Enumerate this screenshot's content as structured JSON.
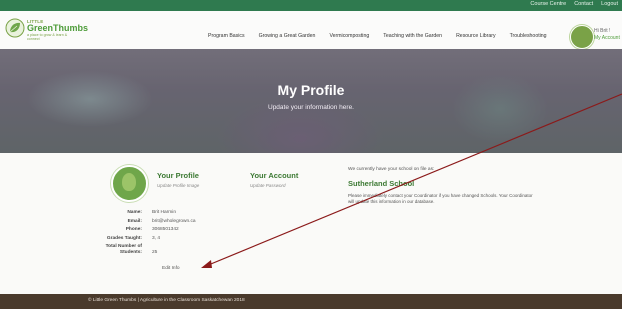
{
  "topbar": {
    "links": [
      "Course Centre",
      "Contact",
      "Logout"
    ]
  },
  "logo": {
    "little": "LITTLE",
    "name": "GreenThumbs",
    "tagline": "a place to grow & learn & connect"
  },
  "nav": [
    "Program Basics",
    "Growing a Great Garden",
    "Vermicomposting",
    "Teaching with the Garden",
    "Resource Library",
    "Troubleshooting"
  ],
  "user": {
    "greeting": "Hi Brit !",
    "account_link": "My Account"
  },
  "hero": {
    "title": "My Profile",
    "subtitle": "Update your information here."
  },
  "profile": {
    "heading": "Your Profile",
    "image_link": "Update Profile Image",
    "fields": [
      {
        "label": "Name:",
        "value": "Brit Harmin"
      },
      {
        "label": "Email:",
        "value": "brit@wholegrown.ca"
      },
      {
        "label": "Phone:",
        "value": "3068501342"
      },
      {
        "label": "Grades Taught:",
        "value": "3, 4"
      },
      {
        "label": "Total Number of Students:",
        "value": "25"
      }
    ],
    "edit_link": "Edit Info"
  },
  "account": {
    "heading": "Your Account",
    "password_link": "Update Password"
  },
  "school": {
    "intro": "We currently have your school on file as:",
    "name": "Sutherland School",
    "note": "Please immediately contact your Coordinator if you have changed Schools. Your Coordinator will update this information in our database."
  },
  "footer": {
    "text": "© Little Green Thumbs | Agriculture in the Classroom Saskatchewan 2018"
  },
  "colors": {
    "topbar": "#2f7a4f",
    "accent_green": "#3d7a34",
    "footer": "#4a3a2c",
    "arrow": "#8b1a1a"
  }
}
